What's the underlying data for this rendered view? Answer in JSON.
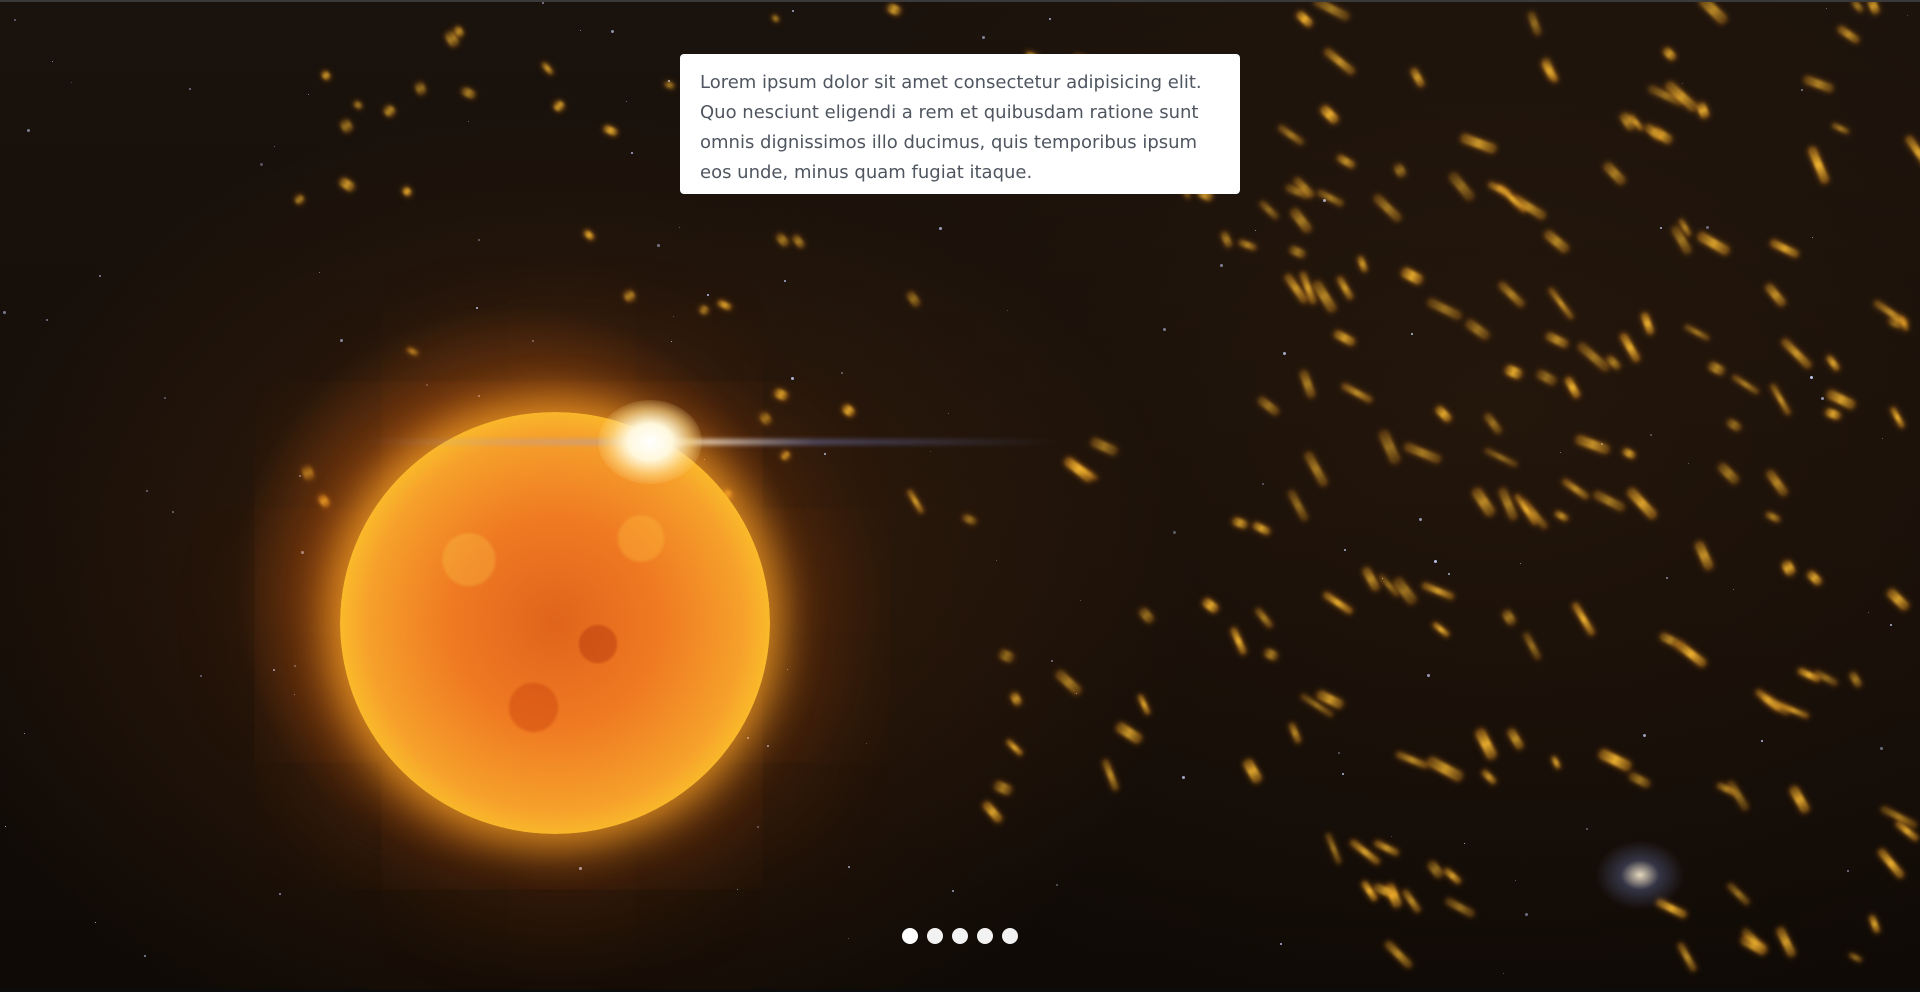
{
  "slide": {
    "background": "sun in space with orange particles",
    "caption": "Lorem ipsum dolor sit amet consectetur adipisicing elit. Quo nesciunt eligendi a rem et quibusdam ratione sunt omnis dignissimos illo ducimus, quis temporibus ipsum eos unde, minus quam fugiat itaque."
  },
  "pagination": {
    "count": 5,
    "active_index": 0
  },
  "colors": {
    "caption_background": "#ffffff",
    "caption_text": "#4f5660",
    "dot": "#f2f2f2",
    "sun_core": "#e0641c",
    "sun_rim": "#fff23a",
    "particle": "#ffb732"
  }
}
